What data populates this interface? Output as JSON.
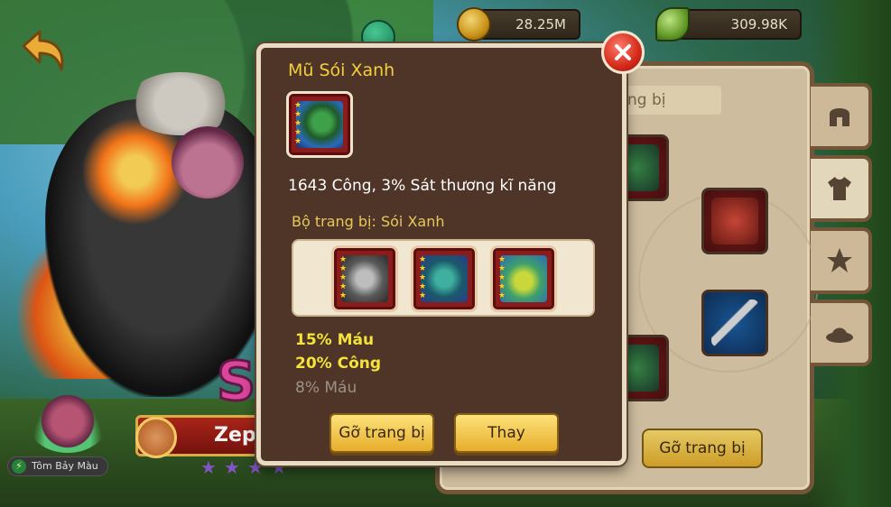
{
  "currencies": {
    "gold": {
      "icon": "gold-coin-icon",
      "value": "28.25M"
    },
    "leaf": {
      "icon": "leaf-icon",
      "value": "309.98K"
    }
  },
  "back_panel": {
    "title_fragment": "ng bị",
    "remove_button": "Gỡ trang bị"
  },
  "side_tabs": [
    {
      "name": "helmet",
      "icon": "helmet-icon"
    },
    {
      "name": "armor",
      "icon": "shirt-icon"
    },
    {
      "name": "accessory",
      "icon": "star-emblem-icon"
    },
    {
      "name": "hat",
      "icon": "hat-icon"
    }
  ],
  "hero": {
    "name": "Zep",
    "rank_letter": "S",
    "stars": 4
  },
  "pet": {
    "label": "Tôm Bảy Màu"
  },
  "modal": {
    "item_name": "Mũ Sói Xanh",
    "item_stars": 5,
    "stat_text": "1643 Công, 3% Sát thương kĩ năng",
    "set_label": "Bộ trang bị: Sói Xanh",
    "set_items": [
      {
        "name": "armor-piece",
        "stars": 5
      },
      {
        "name": "gloves-piece",
        "stars": 5
      },
      {
        "name": "boots-piece",
        "stars": 5
      }
    ],
    "bonuses": [
      {
        "text": "15% Máu",
        "active": true
      },
      {
        "text": "20% Công",
        "active": true
      },
      {
        "text": "8% Máu",
        "active": false
      }
    ],
    "remove_button": "Gỡ trang bị",
    "replace_button": "Thay"
  },
  "colors": {
    "title_gold": "#f3cf3c",
    "bonus_active": "#f3e33c",
    "bonus_inactive": "#9c9188",
    "modal_bg": "#4f3528"
  }
}
